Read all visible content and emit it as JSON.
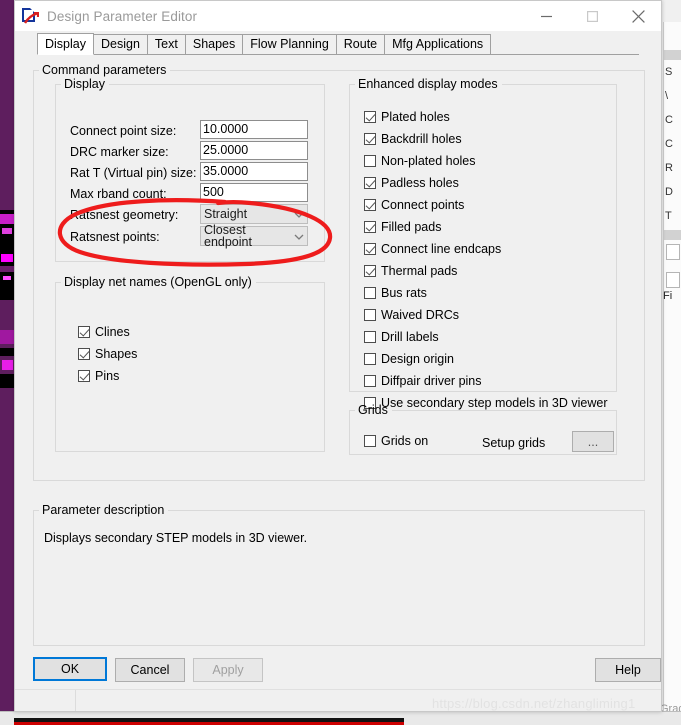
{
  "window": {
    "title": "Design Parameter Editor",
    "icon": "app-document-icon",
    "controls": {
      "minimize": "minimize-icon",
      "maximize": "maximize-icon",
      "close": "close-icon"
    }
  },
  "tabs": [
    {
      "label": "Display",
      "active": true
    },
    {
      "label": "Design",
      "active": false
    },
    {
      "label": "Text",
      "active": false
    },
    {
      "label": "Shapes",
      "active": false
    },
    {
      "label": "Flow Planning",
      "active": false
    },
    {
      "label": "Route",
      "active": false
    },
    {
      "label": "Mfg Applications",
      "active": false
    }
  ],
  "command_parameters": {
    "legend": "Command parameters",
    "display_group": {
      "legend": "Display",
      "fields": [
        {
          "label": "Connect point size:",
          "value": "10.0000",
          "type": "text"
        },
        {
          "label": "DRC marker size:",
          "value": "25.0000",
          "type": "text"
        },
        {
          "label": "Rat T (Virtual pin) size:",
          "value": "35.0000",
          "type": "text"
        },
        {
          "label": "Max rband count:",
          "value": "500",
          "type": "text"
        },
        {
          "label": "Ratsnest geometry:",
          "value": "Straight",
          "type": "combo"
        },
        {
          "label": "Ratsnest points:",
          "value": "Closest endpoint",
          "type": "combo"
        }
      ]
    },
    "net_names_group": {
      "legend": "Display net names (OpenGL only)",
      "items": [
        {
          "label": "Clines",
          "checked": true
        },
        {
          "label": "Shapes",
          "checked": true
        },
        {
          "label": "Pins",
          "checked": true
        }
      ]
    },
    "enhanced_group": {
      "legend": "Enhanced display modes",
      "items": [
        {
          "label": "Plated holes",
          "checked": true
        },
        {
          "label": "Backdrill holes",
          "checked": true
        },
        {
          "label": "Non-plated holes",
          "checked": false
        },
        {
          "label": "Padless holes",
          "checked": true
        },
        {
          "label": "Connect points",
          "checked": true
        },
        {
          "label": "Filled pads",
          "checked": true
        },
        {
          "label": "Connect line endcaps",
          "checked": true
        },
        {
          "label": "Thermal pads",
          "checked": true
        },
        {
          "label": "Bus rats",
          "checked": false
        },
        {
          "label": "Waived DRCs",
          "checked": false
        },
        {
          "label": "Drill labels",
          "checked": false
        },
        {
          "label": "Design origin",
          "checked": false
        },
        {
          "label": "Diffpair driver pins",
          "checked": false
        },
        {
          "label": "Use secondary step models in 3D viewer",
          "checked": false
        }
      ]
    },
    "grids_group": {
      "legend": "Grids",
      "grids_on": {
        "label": "Grids on",
        "checked": false
      },
      "setup_label": "Setup grids",
      "setup_button": "..."
    }
  },
  "parameter_description": {
    "legend": "Parameter description",
    "text": "Displays secondary STEP models in 3D viewer."
  },
  "footer": {
    "ok": "OK",
    "cancel": "Cancel",
    "apply": "Apply",
    "help": "Help"
  },
  "annotation": {
    "type": "red-ellipse-highlight",
    "color": "#ee1c1c",
    "targets": "Ratsnest geometry / Ratsnest points"
  },
  "watermark": "https://blog.csdn.net/zhangliming1",
  "background": {
    "right_panel_lines": [
      "Fi",
      "S",
      "\\",
      "C",
      "C",
      "R",
      "D",
      "T"
    ],
    "bottom_text": "Grade"
  },
  "colors": {
    "accent": "#0078d7",
    "annotation": "#ee1c1c",
    "dialog_bg": "#f0f0f0",
    "desktop_purple": "#5e1e5e"
  }
}
